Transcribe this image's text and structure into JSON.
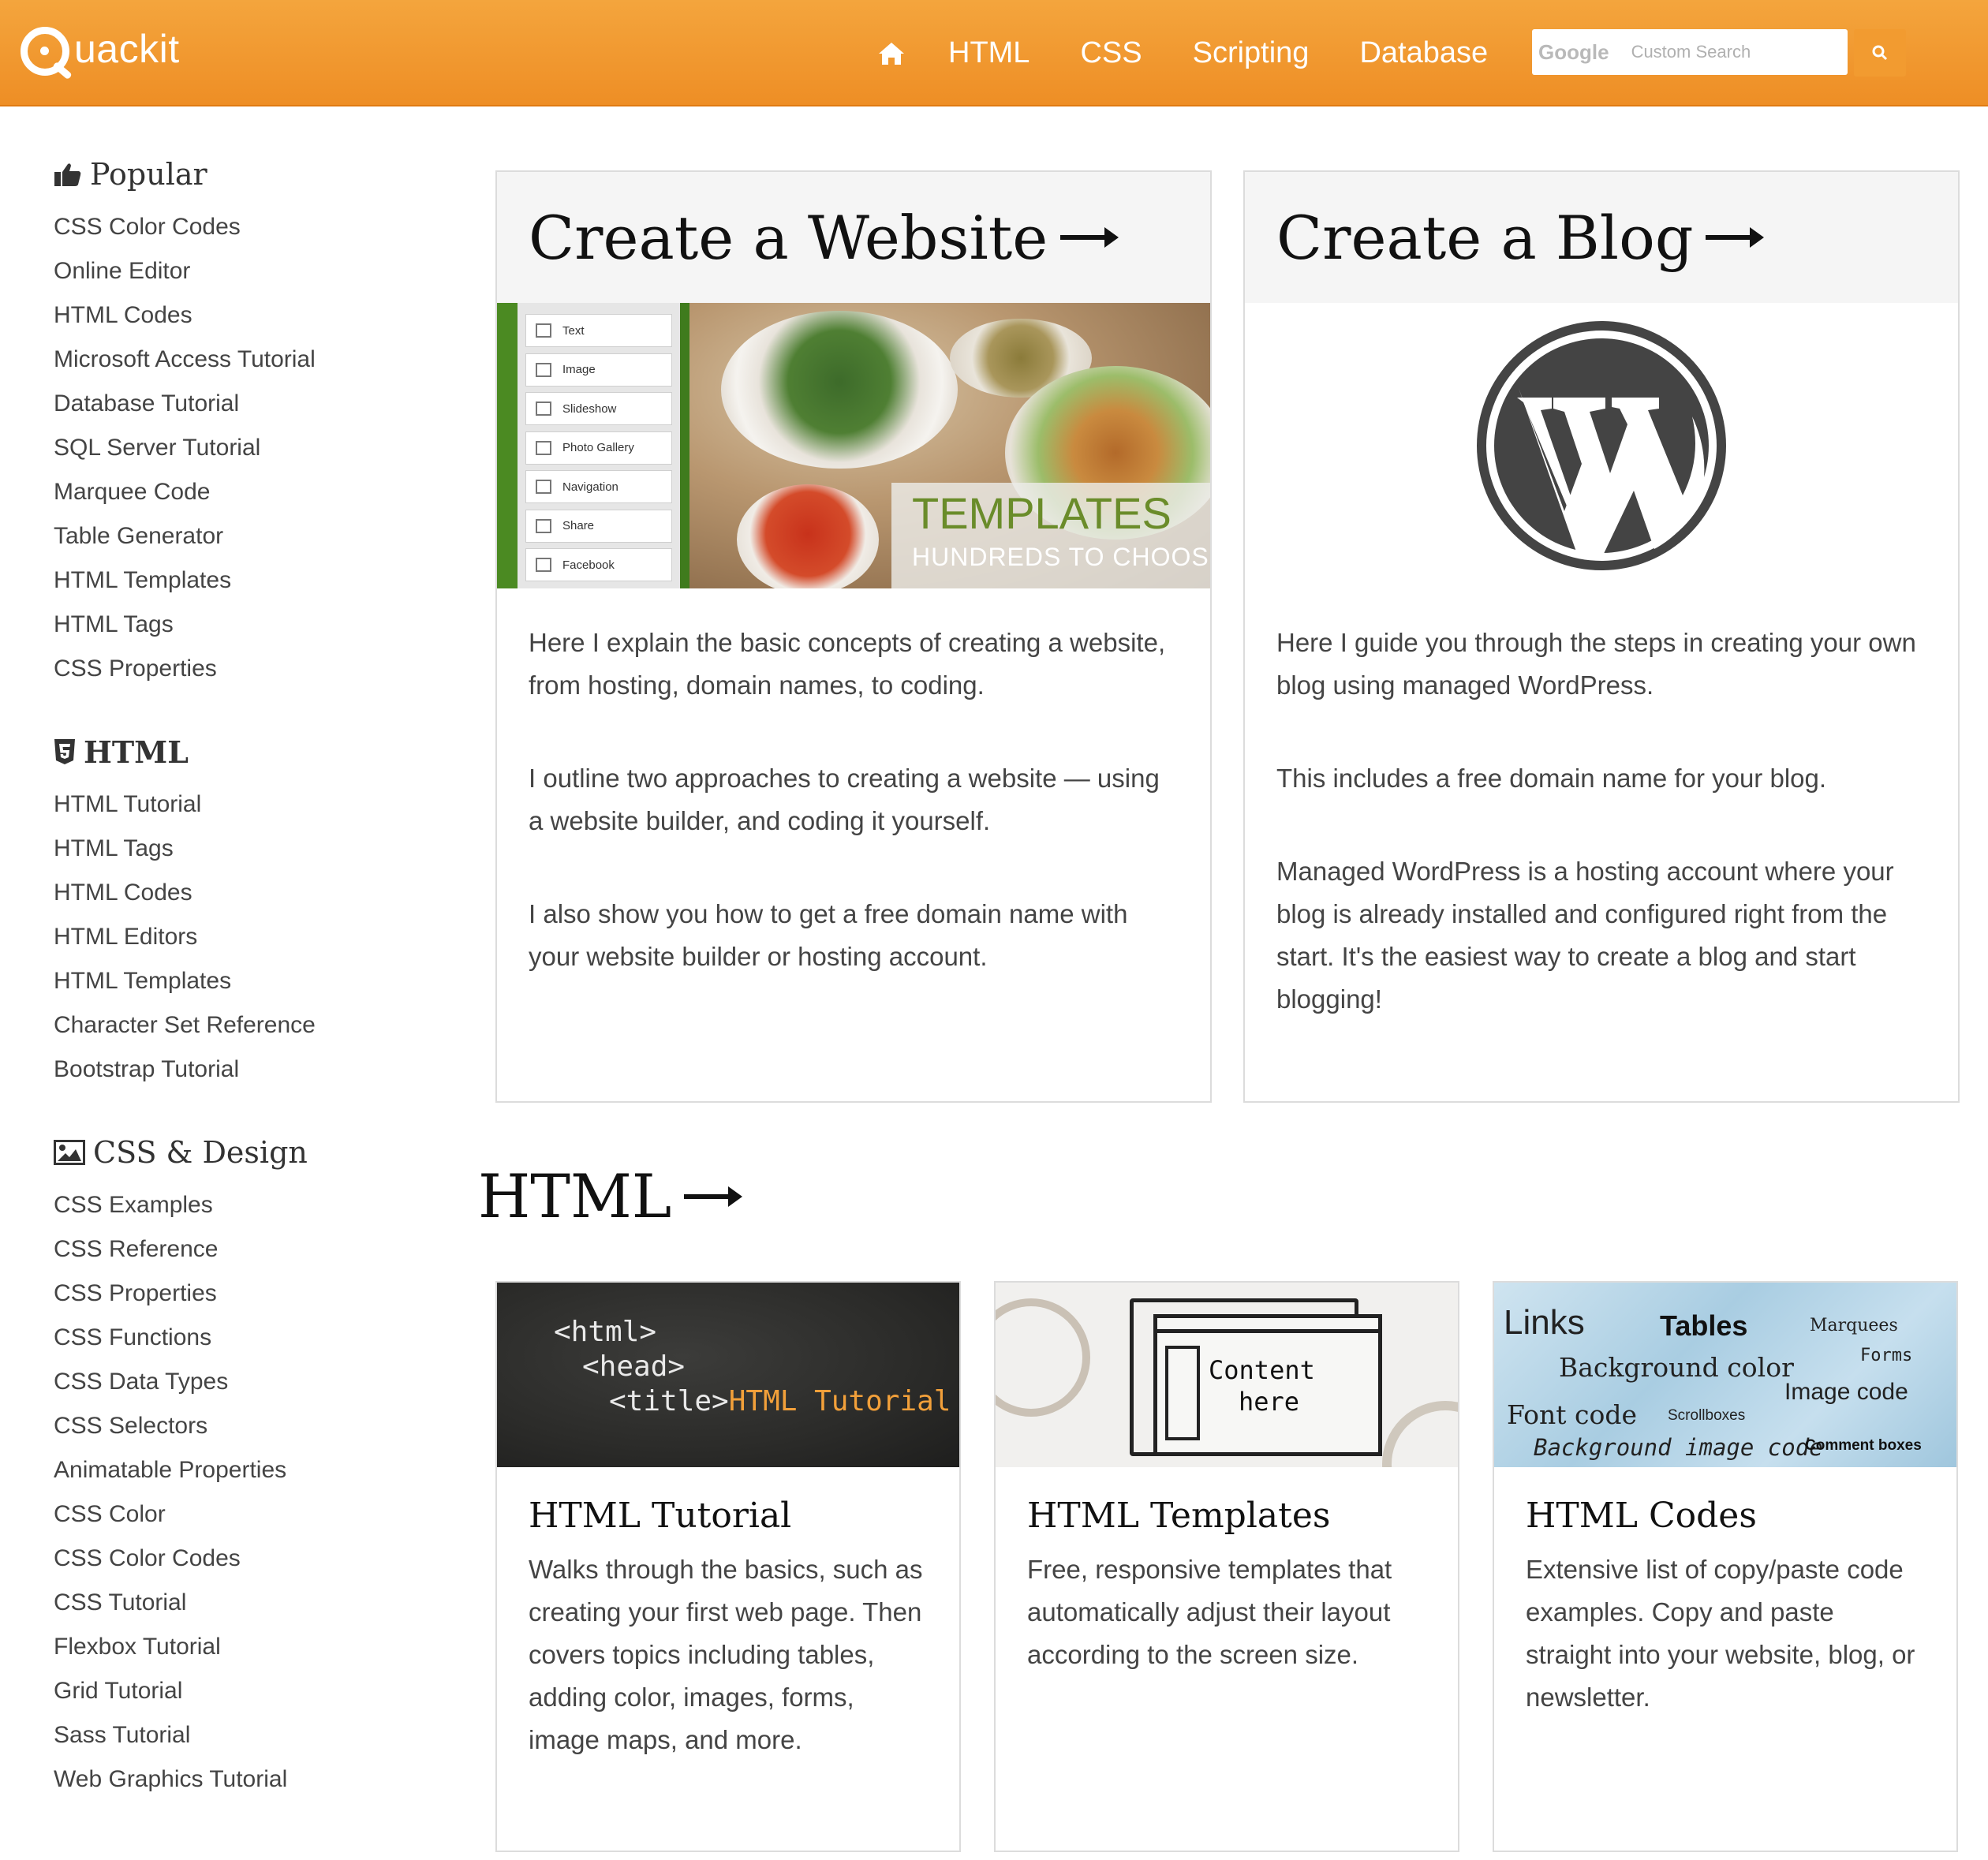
{
  "header": {
    "logo_text": "uackit",
    "nav": [
      "HTML",
      "CSS",
      "Scripting",
      "Database"
    ],
    "search_brand": "Google",
    "search_placeholder": "Custom Search"
  },
  "sidebar": {
    "popular": {
      "heading": "Popular",
      "items": [
        "CSS Color Codes",
        "Online Editor",
        "HTML Codes",
        "Microsoft Access Tutorial",
        "Database Tutorial",
        "SQL Server Tutorial",
        "Marquee Code",
        "Table Generator",
        "HTML Templates",
        "HTML Tags",
        "CSS Properties"
      ]
    },
    "html": {
      "heading": "HTML",
      "items": [
        "HTML Tutorial",
        "HTML Tags",
        "HTML Codes",
        "HTML Editors",
        "HTML Templates",
        "Character Set Reference",
        "Bootstrap Tutorial"
      ]
    },
    "css": {
      "heading": "CSS & Design",
      "items": [
        "CSS Examples",
        "CSS Reference",
        "CSS Properties",
        "CSS Functions",
        "CSS Data Types",
        "CSS Selectors",
        "Animatable Properties",
        "CSS Color",
        "CSS Color Codes",
        "CSS Tutorial",
        "Flexbox Tutorial",
        "Grid Tutorial",
        "Sass Tutorial",
        "Web Graphics Tutorial"
      ]
    }
  },
  "website_card": {
    "title": "Create a Website",
    "builder_items": [
      "Text",
      "Image",
      "Slideshow",
      "Photo Gallery",
      "Navigation",
      "Share",
      "Facebook"
    ],
    "banner_title": "TEMPLATES",
    "banner_sub": "HUNDREDS TO CHOOSE F",
    "paragraphs": [
      "Here I explain the basic concepts of creating a website, from hosting, domain names, to coding.",
      "I outline two approaches to creating a website — using a website builder, and coding it yourself.",
      "I also show you how to get a free domain name with your website builder or hosting account."
    ]
  },
  "blog_card": {
    "title": "Create a Blog",
    "paragraphs": [
      "Here I guide you through the steps in creating your own blog using managed WordPress.",
      "This includes a free domain name for your blog.",
      "Managed WordPress is a hosting account where your blog is already installed and configured right from the start. It's the easiest way to create a blog and start blogging!"
    ]
  },
  "html_section": {
    "title": "HTML",
    "tiles": [
      {
        "title": "HTML Tutorial",
        "desc": "Walks through the basics, such as creating your first web page. Then covers topics including tables, adding color, images, forms, image maps, and more.",
        "img_lines": [
          "<html>",
          "<head>",
          "<title>",
          "HTML Tutorial"
        ]
      },
      {
        "title": "HTML Templates",
        "desc": "Free, responsive templates that automatically adjust their layout according to the screen size.",
        "img_lines": [
          "Content",
          "here"
        ]
      },
      {
        "title": "HTML Codes",
        "desc": "Extensive list of copy/paste code examples. Copy and paste straight into your website, blog, or newsletter.",
        "img_words": [
          "Links",
          "Tables",
          "Marquees",
          "Forms",
          "Background color",
          "Image code",
          "Font code",
          "Scrollboxes",
          "Background image code",
          "Comment boxes"
        ]
      }
    ]
  },
  "colors": {
    "header": "#f29b30",
    "card_border": "#dcdcdc",
    "card_head": "#f5f5f5",
    "text": "#444444"
  }
}
